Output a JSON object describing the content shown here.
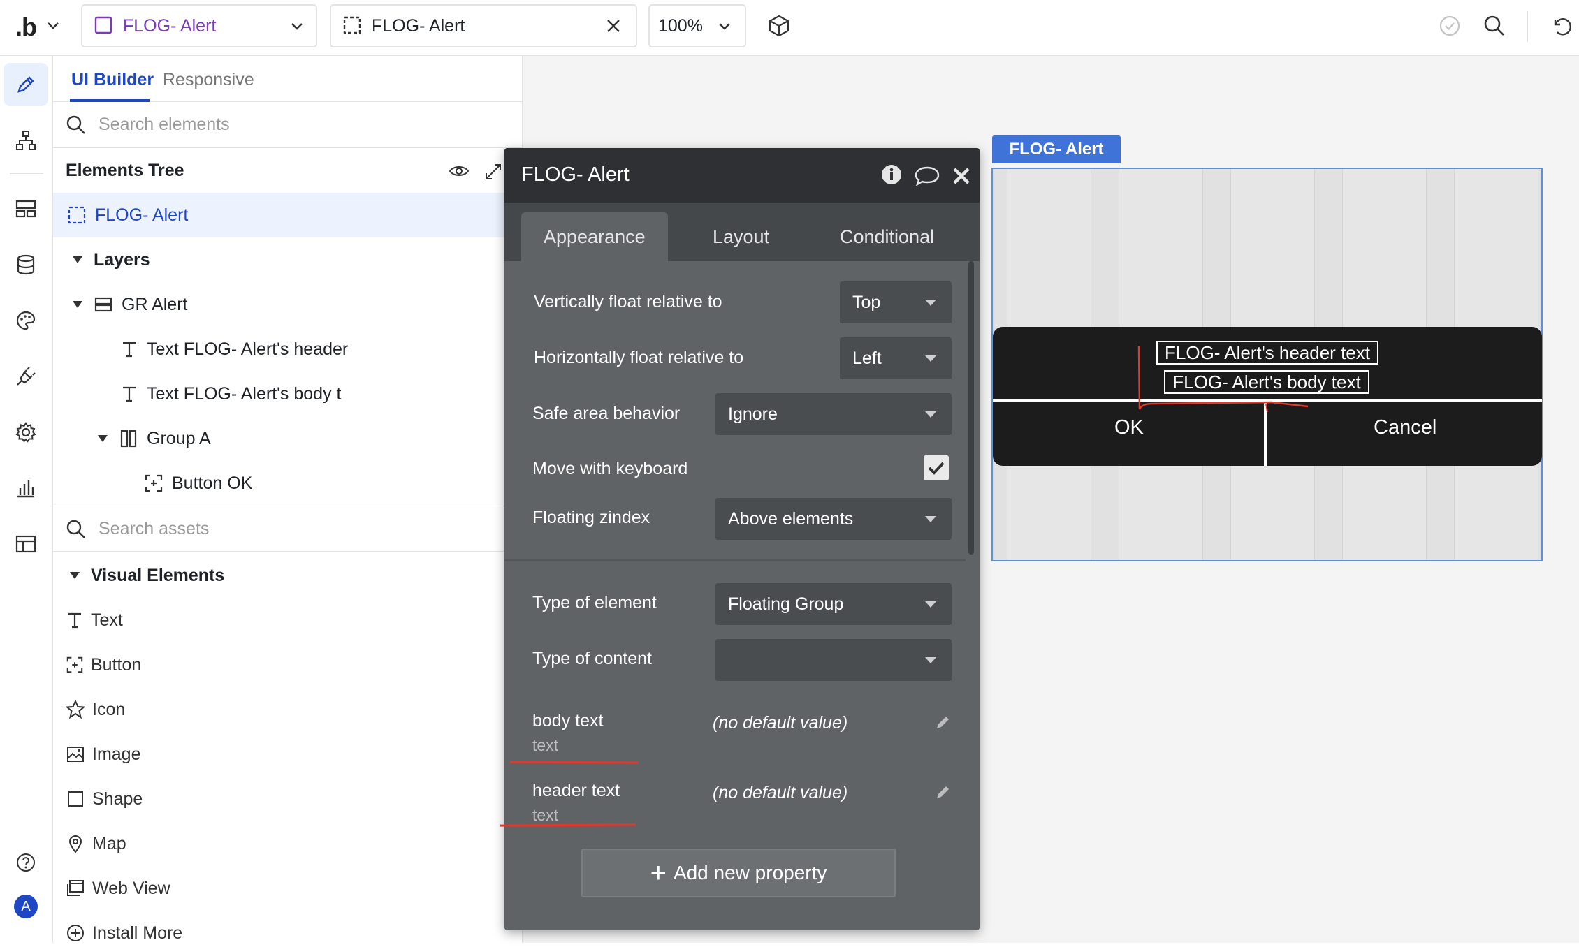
{
  "topbar": {
    "logo": ".b",
    "page_name": "FLOG- Alert",
    "element_name": "FLOG- Alert",
    "zoom": "100%"
  },
  "left_panel": {
    "tabs": [
      "UI Builder",
      "Responsive"
    ],
    "search_elements_placeholder": "Search elements",
    "elements_tree_title": "Elements Tree",
    "tree": {
      "root": "FLOG- Alert",
      "layers": "Layers",
      "group_alert": "GR Alert",
      "text_header": "Text FLOG- Alert's header",
      "text_body": "Text FLOG- Alert's body t",
      "group_a": "Group A",
      "button_ok": "Button OK"
    },
    "search_assets_placeholder": "Search assets",
    "visual_elements_title": "Visual Elements",
    "visual_elements": [
      "Text",
      "Button",
      "Icon",
      "Image",
      "Shape",
      "Map",
      "Web View",
      "Install More"
    ]
  },
  "editor": {
    "title": "FLOG- Alert",
    "tabs": [
      "Appearance",
      "Layout",
      "Conditional"
    ],
    "props": {
      "vfloat_label": "Vertically float relative to",
      "vfloat_value": "Top",
      "hfloat_label": "Horizontally float relative to",
      "hfloat_value": "Left",
      "safe_area_label": "Safe area behavior",
      "safe_area_value": "Ignore",
      "move_keyboard_label": "Move with keyboard",
      "floating_zindex_label": "Floating zindex",
      "floating_zindex_value": "Above elements",
      "type_element_label": "Type of element",
      "type_element_value": "Floating Group",
      "type_content_label": "Type of content",
      "type_content_value": ""
    },
    "custom_props": [
      {
        "name": "body text",
        "type": "text",
        "default": "(no default value)"
      },
      {
        "name": "header text",
        "type": "text",
        "default": "(no default value)"
      }
    ],
    "add_property": "Add new property"
  },
  "canvas": {
    "floating_group_label": "FLOG- Alert",
    "alert_header": "FLOG- Alert's header text",
    "alert_body": "FLOG- Alert's body text",
    "ok_label": "OK",
    "cancel_label": "Cancel"
  }
}
